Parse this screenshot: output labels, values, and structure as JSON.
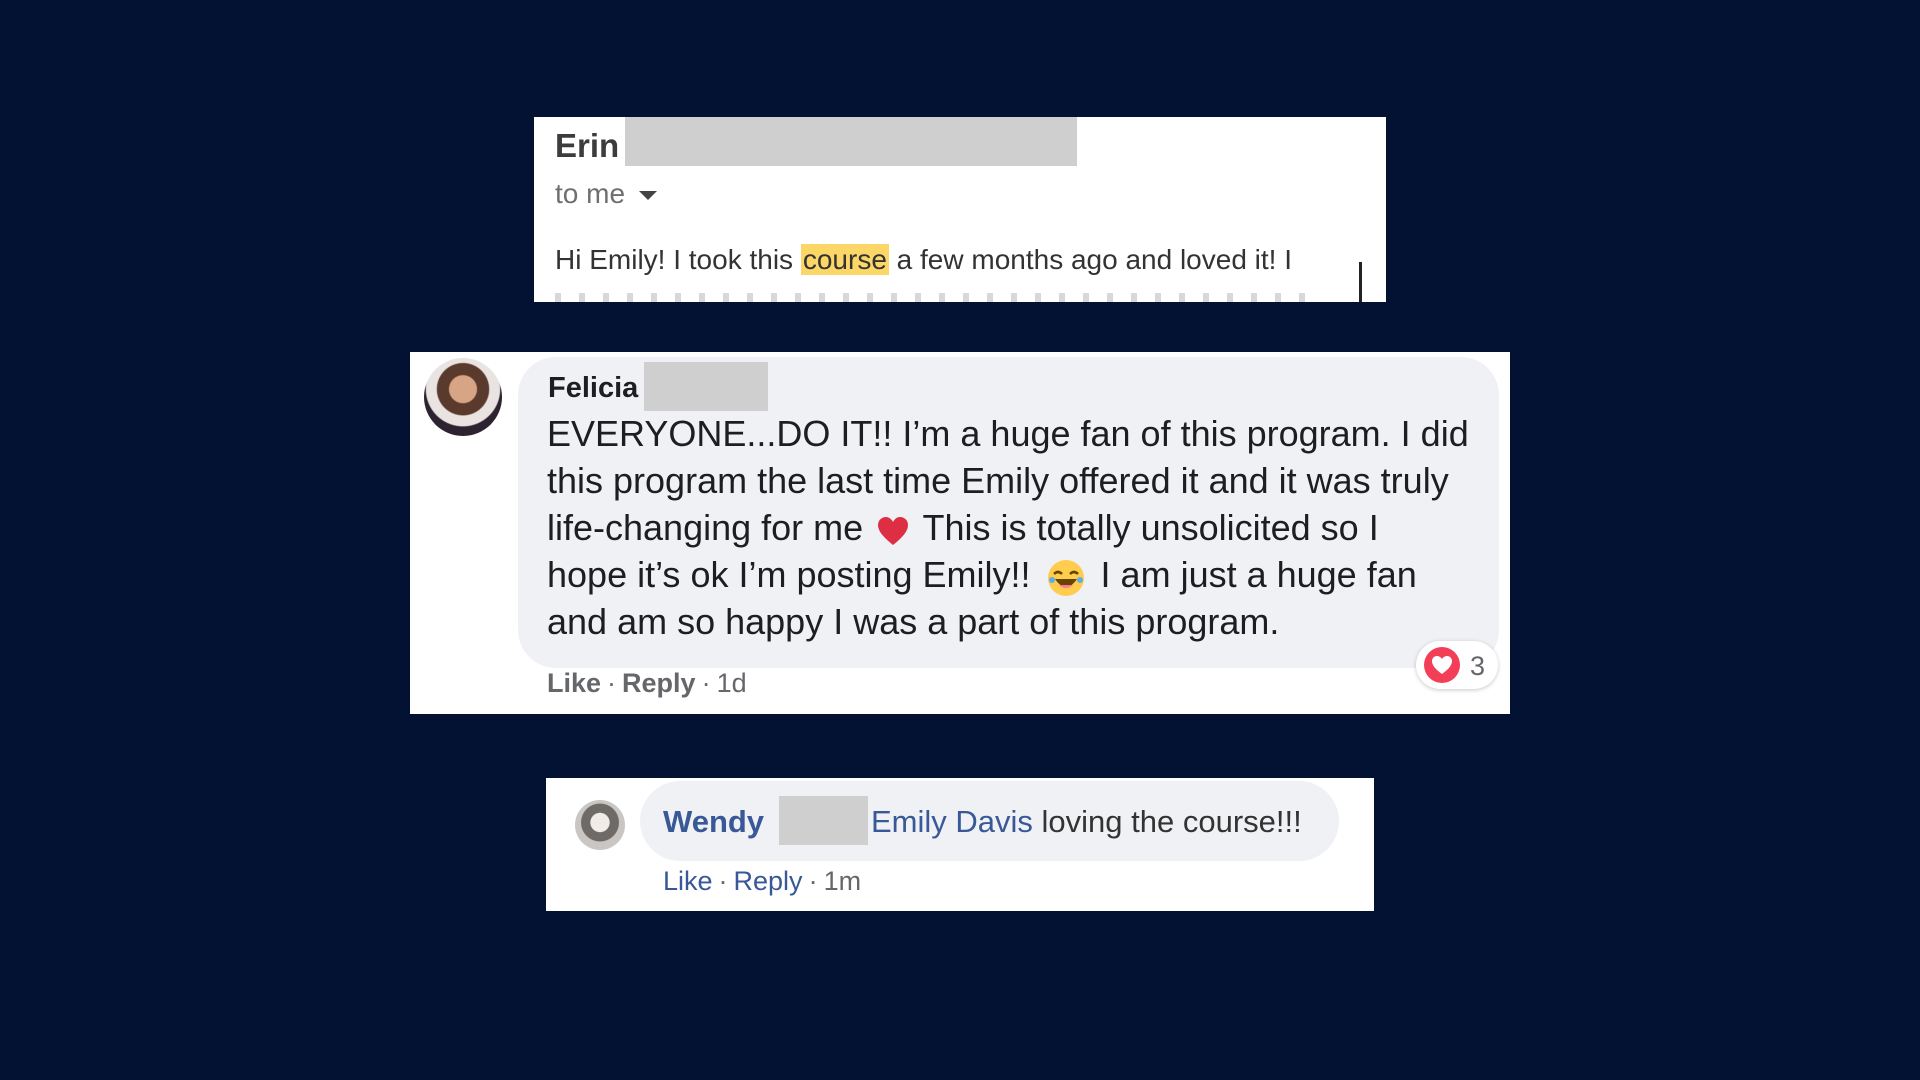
{
  "email": {
    "sender": "Erin",
    "recipient_label": "to me",
    "body_before": "Hi Emily! I took this ",
    "body_highlight": "course",
    "body_after": " a few months ago and loved it! I"
  },
  "comment1": {
    "author": "Felicia",
    "line1": "EVERYONE...DO IT!! I’m a huge fan of this program. I did",
    "line2": "this program the last time Emily offered it and it was truly",
    "line3a": "life-changing for me ",
    "line3b": " This is totally unsolicited so I",
    "line4a": "hope it’s ok I’m posting Emily!! ",
    "line4b": " I am just a huge fan",
    "line5": "and am so happy I was a part of this program.",
    "reaction_count": "3",
    "like_label": "Like",
    "reply_label": "Reply",
    "separator": "·",
    "time": "1d"
  },
  "comment2": {
    "author": "Wendy",
    "mention": "Emily Davis",
    "text": " loving the course!!!",
    "like_label": "Like",
    "reply_label": "Reply",
    "separator": "·",
    "time": "1m"
  },
  "icons": {
    "heart_inline": "red-heart-emoji",
    "laugh": "tears-of-joy-emoji",
    "reaction": "love-reaction",
    "caret": "chevron-down"
  },
  "colors": {
    "background": "#031133",
    "highlight": "#fcd767",
    "link_blue": "#385898",
    "reaction_red": "#f33e58"
  }
}
